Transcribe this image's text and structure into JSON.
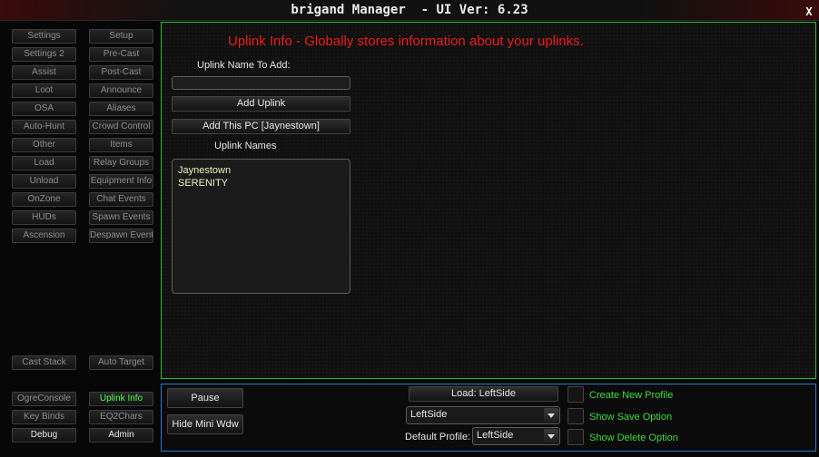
{
  "window": {
    "title": "brigand Manager  - UI Ver: 6.23",
    "close_label": "X"
  },
  "nav": {
    "rows": [
      [
        "Settings",
        "Setup"
      ],
      [
        "Settings 2",
        "Pre-Cast"
      ],
      [
        "Assist",
        "Post-Cast"
      ],
      [
        "Loot",
        "Announce"
      ],
      [
        "OSA",
        "Aliases"
      ],
      [
        "Auto-Hunt",
        "Crowd Control"
      ],
      [
        "Other",
        "Items"
      ],
      [
        "Load",
        "Relay Groups"
      ],
      [
        "Unload",
        "Equipment Info"
      ],
      [
        "OnZone",
        "Chat Events"
      ],
      [
        "HUDs",
        "Spawn Events"
      ],
      [
        "Ascension",
        "Despawn Event"
      ]
    ],
    "cast_stack": "Cast Stack",
    "auto_target": "Auto Target",
    "ogre_console": "OgreConsole",
    "uplink_info": "Uplink Info",
    "key_binds": "Key Binds",
    "eq2chars": "EQ2Chars",
    "debug": "Debug",
    "admin": "Admin"
  },
  "panel": {
    "title": "Uplink Info - Globally stores information about your uplinks.",
    "name_label": "Uplink Name To Add:",
    "name_value": "",
    "add_uplink": "Add Uplink",
    "add_this_pc": "Add This PC [Jaynestown]",
    "list_label": "Uplink Names",
    "uplinks": [
      "Jaynestown",
      "SERENITY"
    ]
  },
  "bottom": {
    "pause": "Pause",
    "hide_mini": "Hide Mini Wdw",
    "load_button": "Load: LeftSide",
    "profile_select": "LeftSide",
    "default_profile_label": "Default Profile:",
    "default_profile_select": "LeftSide",
    "create_new_profile": "Create New Profile",
    "show_save_option": "Show Save Option",
    "show_delete_option": "Show Delete Option"
  },
  "colors": {
    "panel_border": "#27c427",
    "bottom_border": "#2a78d8",
    "title_red": "#ee1c1c",
    "active_green": "#4cff4c"
  }
}
